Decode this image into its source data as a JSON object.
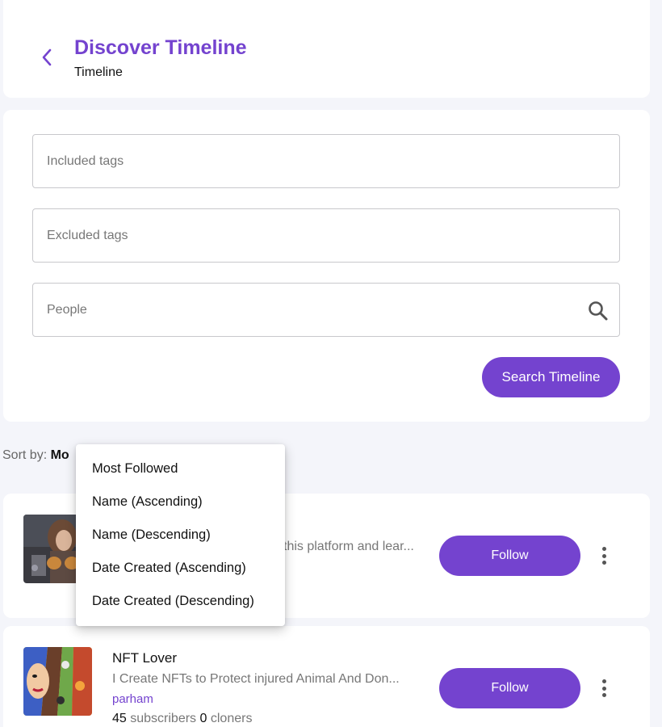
{
  "header": {
    "title": "Discover Timeline",
    "subtitle": "Timeline",
    "back_icon": "chevron-left-icon"
  },
  "filters": {
    "included_tags_placeholder": "Included tags",
    "included_tags_value": "",
    "excluded_tags_placeholder": "Excluded tags",
    "excluded_tags_value": "",
    "people_placeholder": "People",
    "people_value": "",
    "search_icon": "search-icon",
    "search_button_label": "Search Timeline"
  },
  "sort": {
    "label": "Sort by:",
    "current_visible": "Mo",
    "options": [
      "Most Followed",
      "Name (Ascending)",
      "Name (Descending)",
      "Date Created (Ascending)",
      "Date Created (Descending)"
    ]
  },
  "items": [
    {
      "name": "",
      "description": "this platform and lear...",
      "owner": "",
      "follow_label": "Follow",
      "more_icon": "more-vertical-icon"
    },
    {
      "name": "NFT Lover",
      "description": "I Create NFTs to Protect injured Animal And Don...",
      "owner": "parham",
      "subscribers_count": "45",
      "subscribers_label": "subscribers",
      "cloners_count": "0",
      "cloners_label": "cloners",
      "follow_label": "Follow",
      "more_icon": "more-vertical-icon"
    }
  ],
  "colors": {
    "accent": "#7443cf",
    "background": "#f4f5fa",
    "card": "#ffffff"
  }
}
